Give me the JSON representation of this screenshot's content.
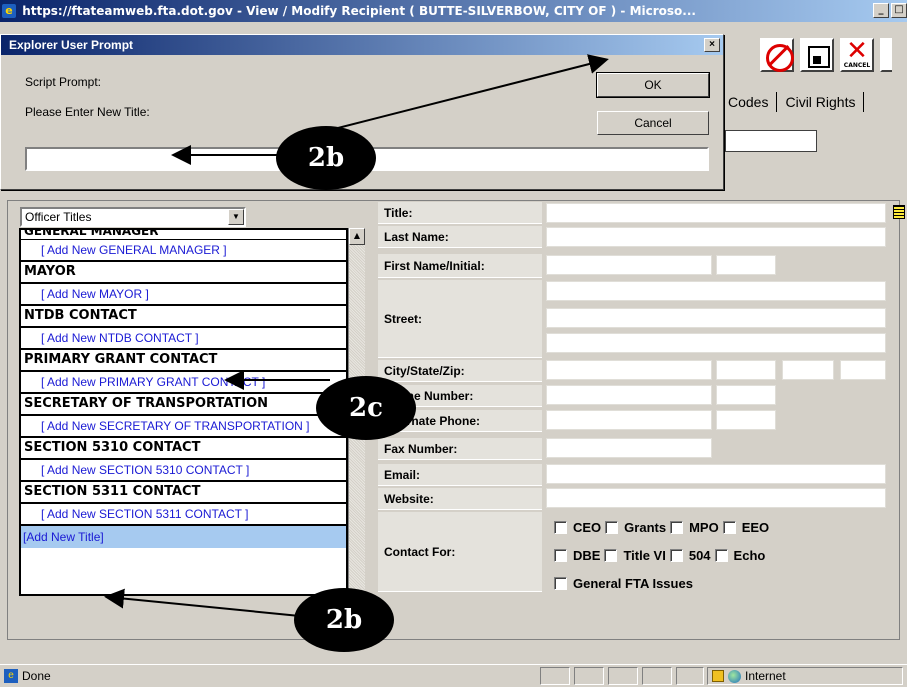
{
  "window": {
    "title": "https://ftateamweb.fta.dot.gov - View / Modify Recipient ( BUTTE-SILVERBOW, CITY OF ) - Microso...",
    "min_label": "_",
    "max_label": "□"
  },
  "tabs": [
    "Codes",
    "Civil Rights"
  ],
  "dialog": {
    "title": "Explorer User Prompt",
    "close": "×",
    "script_prompt": "Script Prompt:",
    "prompt_text": "Please Enter New Title:",
    "ok": "OK",
    "cancel": "Cancel",
    "input_value": ""
  },
  "officer_select": {
    "value": "Officer Titles"
  },
  "list": {
    "cut_header": "GENERAL MANAGER",
    "items": [
      {
        "add": "[ Add New GENERAL MANAGER ]"
      },
      {
        "head": "MAYOR",
        "add": "[ Add New MAYOR ]"
      },
      {
        "head": "NTDB CONTACT",
        "add": "[ Add New NTDB CONTACT ]"
      },
      {
        "head": "PRIMARY GRANT CONTACT",
        "add": "[ Add New PRIMARY GRANT CONTACT ]"
      },
      {
        "head": "SECRETARY OF TRANSPORTATION",
        "add": "[ Add New SECRETARY OF TRANSPORTATION ]"
      },
      {
        "head": "SECTION 5310 CONTACT",
        "add": "[ Add New SECTION 5310 CONTACT ]"
      },
      {
        "head": "SECTION 5311 CONTACT",
        "add": "[ Add New SECTION 5311 CONTACT ]"
      }
    ],
    "add_new_title": "[Add New Title]"
  },
  "form": {
    "title": "Title:",
    "last_name": "Last Name:",
    "first_name": "First Name/Initial:",
    "street": "Street:",
    "city_state_zip": "City/State/Zip:",
    "phone_number": "Phone Number:",
    "alternate_phone": "Alternate Phone:",
    "fax_number": "Fax Number:",
    "email": "Email:",
    "website": "Website:",
    "contact_for": "Contact For:",
    "checkboxes_row1": [
      "CEO",
      "Grants",
      "MPO",
      "EEO"
    ],
    "checkboxes_row2": [
      "DBE",
      "Title VI",
      "504",
      "Echo"
    ],
    "checkboxes_row3": [
      "General FTA Issues"
    ]
  },
  "toolbar": {
    "cancel_caption": "CANCEL"
  },
  "status": {
    "done": "Done",
    "zone": "Internet"
  },
  "annotations": {
    "dialog_callout": "2b",
    "list_callout": "2c",
    "add_title_callout": "2b"
  }
}
